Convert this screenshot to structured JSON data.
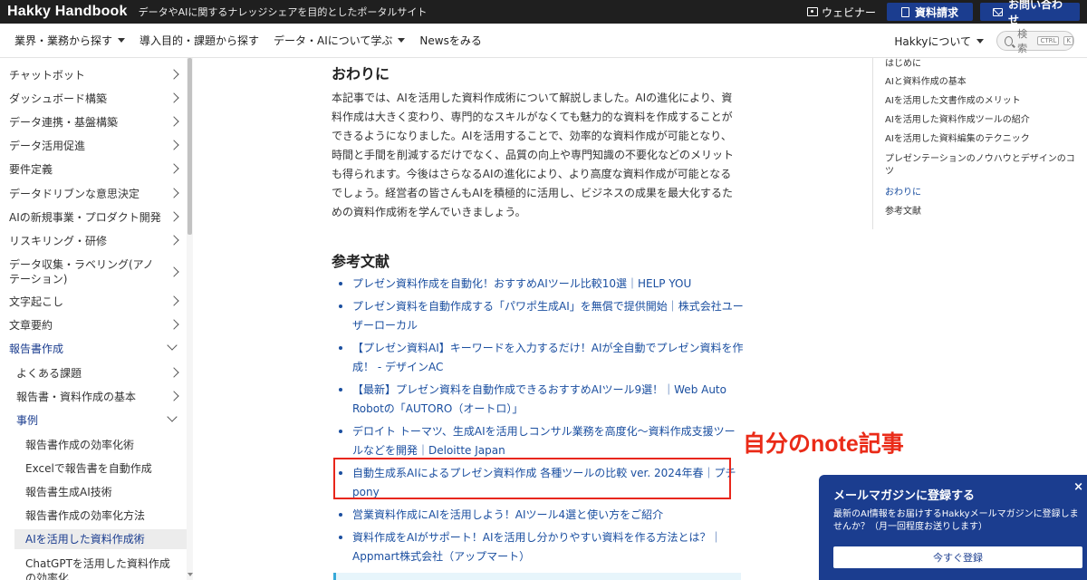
{
  "topbar": {
    "brand": "Hakky Handbook",
    "tagline": "データやAIに関するナレッジシェアを目的としたポータルサイト",
    "webinar_label": "ウェビナー",
    "doc_request_label": "資料請求",
    "contact_label": "お問い合わせ"
  },
  "navbar": {
    "items": [
      {
        "label": "業界・業務から探す",
        "dropdown": true
      },
      {
        "label": "導入目的・課題から探す",
        "dropdown": false
      },
      {
        "label": "データ・AIについて学ぶ",
        "dropdown": true
      },
      {
        "label": "Newsをみる",
        "dropdown": false
      }
    ],
    "about_label": "Hakkyについて",
    "search_placeholder": "検索",
    "search_kbd_1": "CTRL",
    "search_kbd_2": "K"
  },
  "sidebar": {
    "items": [
      {
        "label": "チャットボット"
      },
      {
        "label": "ダッシュボード構築"
      },
      {
        "label": "データ連携・基盤構築"
      },
      {
        "label": "データ活用促進"
      },
      {
        "label": "要件定義"
      },
      {
        "label": "データドリブンな意思決定"
      },
      {
        "label": "AIの新規事業・プロダクト開発"
      },
      {
        "label": "リスキリング・研修"
      },
      {
        "label": "データ収集・ラベリング(アノテーション)"
      },
      {
        "label": "文字起こし"
      },
      {
        "label": "文章要約"
      },
      {
        "label": "報告書作成"
      },
      {
        "label": "よくある課題"
      },
      {
        "label": "報告書・資料作成の基本"
      },
      {
        "label": "事例"
      },
      {
        "label": "報告書作成の効率化術"
      },
      {
        "label": "Excelで報告書を自動作成"
      },
      {
        "label": "報告書生成AI技術"
      },
      {
        "label": "報告書作成の効率化方法"
      },
      {
        "label": "AIを活用した資料作成術"
      },
      {
        "label": "ChatGPTを活用した資料作成の効率化"
      }
    ]
  },
  "main": {
    "section_title": "おわりに",
    "body": "本記事では、AIを活用した資料作成術について解説しました。AIの進化により、資料作成は大きく変わり、専門的なスキルがなくても魅力的な資料を作成することができるようになりました。AIを活用することで、効率的な資料作成が可能となり、時間と手間を削減するだけでなく、品質の向上や専門知識の不要化などのメリットも得られます。今後はさらなるAIの進化により、より高度な資料作成が可能となるでしょう。経営者の皆さんもAIを積極的に活用し、ビジネスの成果を最大化するための資料作成術を学んでいきましょう。",
    "references_title": "参考文献",
    "references": [
      {
        "text": "プレゼン資料作成を自動化！おすすめAIツール比較10選｜HELP YOU"
      },
      {
        "text": "プレゼン資料を自動作成する「パワポ生成AI」を無償で提供開始｜株式会社ユーザーローカル"
      },
      {
        "text": "【プレゼン資料AI】キーワードを入力するだけ！AIが全自動でプレゼン資料を作成！ - デザインAC"
      },
      {
        "text": "【最新】プレゼン資料を自動作成できるおすすめAIツール9選！｜Web Auto Robotの「AUTORO（オートロ）」"
      },
      {
        "text": "デロイト トーマツ、生成AIを活用しコンサル業務を高度化〜資料作成支援ツールなどを開発｜Deloitte Japan"
      },
      {
        "text": "自動生成系AIによるプレゼン資料作成 各種ツールの比較 ver. 2024年春｜プチpony"
      },
      {
        "text": "営業資料作成にAIを活用しよう！AIツール4選と使い方をご紹介"
      },
      {
        "text": "資料作成をAIがサポート！AIを活用し分かりやすい資料を作る方法とは？｜Appmart株式会社（アップマート）"
      }
    ],
    "annotation": "自分のnote記事"
  },
  "toc": {
    "items": [
      {
        "label": "はじめに"
      },
      {
        "label": "AIと資料作成の基本"
      },
      {
        "label": "AIを活用した文書作成のメリット"
      },
      {
        "label": "AIを活用した資料作成ツールの紹介"
      },
      {
        "label": "AIを活用した資料編集のテクニック"
      },
      {
        "label": "プレゼンテーションのノウハウとデザインのコツ"
      },
      {
        "label": "おわりに"
      },
      {
        "label": "参考文献"
      }
    ]
  },
  "popup": {
    "title": "メールマガジンに登録する",
    "close": "×",
    "text": "最新のAI情報をお届けするHakkyメールマガジンに登録しませんか？（月一回程度お送りします）",
    "button": "今すぐ登録"
  },
  "colors": {
    "topbar_bg": "#1f1f1f",
    "brand_blue": "#1b3d8f",
    "link_blue": "#1b4fa0",
    "annotation_red": "#e8261b"
  }
}
